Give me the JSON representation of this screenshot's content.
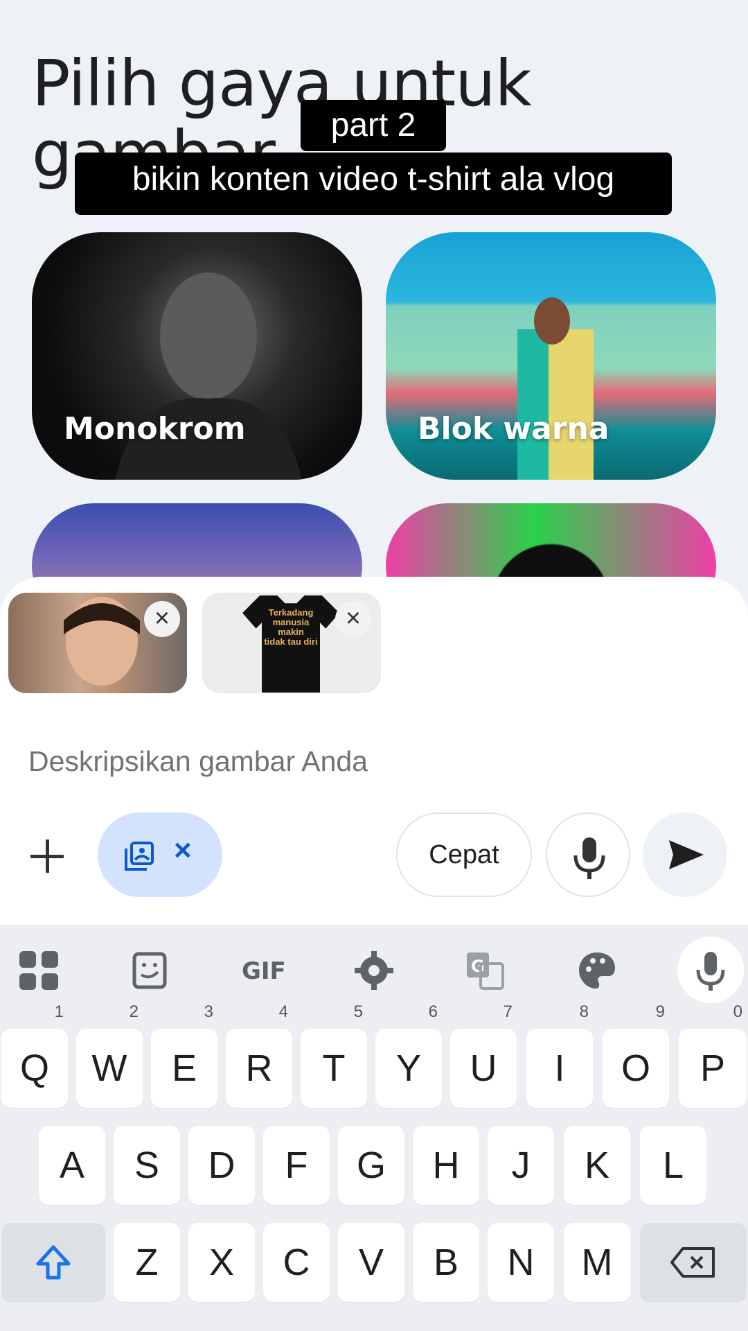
{
  "heading": "Pilih gaya untuk gambar",
  "overlay": {
    "line1": "part 2",
    "line2": "bikin konten video t-shirt ala vlog"
  },
  "styles": [
    {
      "label": "Monokrom"
    },
    {
      "label": "Blok warna"
    },
    {
      "label": ""
    },
    {
      "label": ""
    }
  ],
  "attachments": [
    {
      "kind": "portrait photo"
    },
    {
      "kind": "t-shirt photo",
      "print_text": [
        "Terkadang",
        "manusia",
        "makin",
        "tidak tau diri"
      ]
    }
  ],
  "prompt": {
    "placeholder": "Deskripsikan gambar Anda",
    "value": ""
  },
  "controls": {
    "speed_label": "Cepat"
  },
  "keyboard": {
    "toolbar": [
      "apps-icon",
      "sticker-icon",
      "GIF",
      "settings-icon",
      "translate-icon",
      "palette-icon",
      "mic-icon"
    ],
    "row1": [
      [
        "Q",
        "1"
      ],
      [
        "W",
        "2"
      ],
      [
        "E",
        "3"
      ],
      [
        "R",
        "4"
      ],
      [
        "T",
        "5"
      ],
      [
        "Y",
        "6"
      ],
      [
        "U",
        "7"
      ],
      [
        "I",
        "8"
      ],
      [
        "O",
        "9"
      ],
      [
        "P",
        "0"
      ]
    ],
    "row2": [
      "A",
      "S",
      "D",
      "F",
      "G",
      "H",
      "J",
      "K",
      "L"
    ],
    "row3": [
      "Z",
      "X",
      "C",
      "V",
      "B",
      "N",
      "M"
    ]
  },
  "colors": {
    "accent": "#0b57d0",
    "chip_bg": "#d3e3fd",
    "shift_icon": "#1a73e8"
  }
}
